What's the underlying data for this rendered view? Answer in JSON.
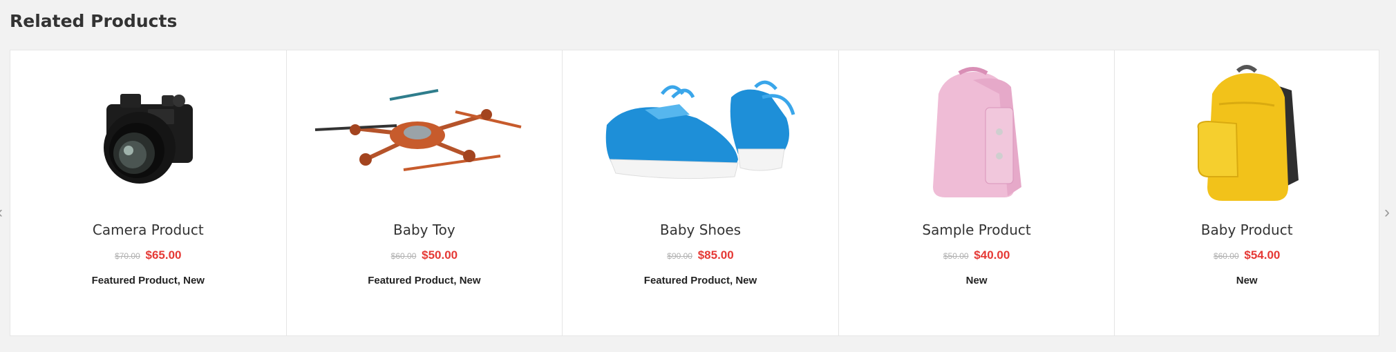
{
  "section": {
    "title": "Related Products"
  },
  "nav": {
    "prev_glyph": "‹",
    "next_glyph": "›"
  },
  "colors": {
    "sale_price": "#e53935",
    "old_price": "#b0b0b0",
    "background": "#f2f2f2"
  },
  "products": [
    {
      "name": "Camera Product",
      "old_price": "$70.00",
      "price": "$65.00",
      "tags": "Featured Product, New",
      "icon": "camera-icon"
    },
    {
      "name": "Baby Toy",
      "old_price": "$60.00",
      "price": "$50.00",
      "tags": "Featured Product, New",
      "icon": "drone-icon"
    },
    {
      "name": "Baby Shoes",
      "old_price": "$90.00",
      "price": "$85.00",
      "tags": "Featured Product, New",
      "icon": "shoes-icon"
    },
    {
      "name": "Sample Product",
      "old_price": "$50.00",
      "price": "$40.00",
      "tags": "New",
      "icon": "pink-backpack-icon"
    },
    {
      "name": "Baby Product",
      "old_price": "$60.00",
      "price": "$54.00",
      "tags": "New",
      "icon": "yellow-backpack-icon"
    }
  ]
}
